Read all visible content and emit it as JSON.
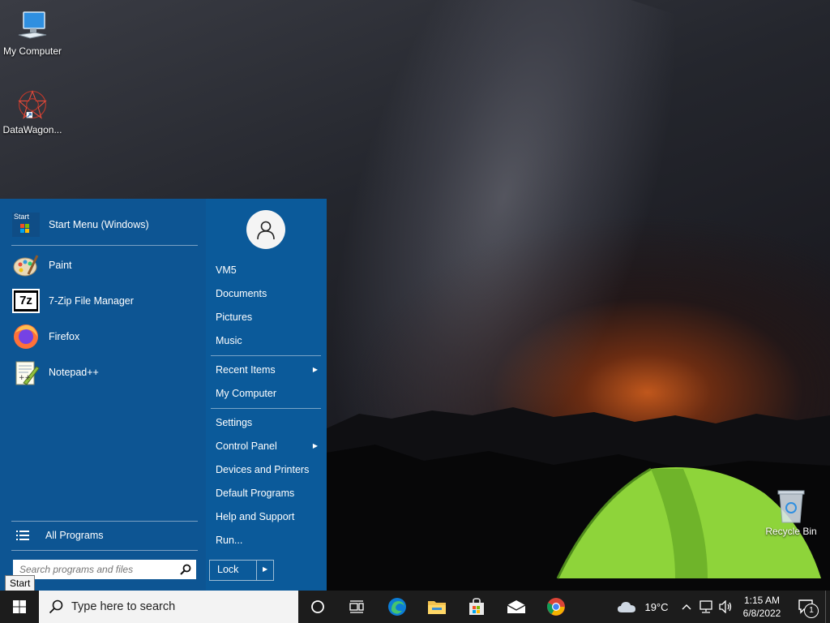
{
  "desktop": {
    "icons": [
      {
        "label": "My Computer",
        "icon": "monitor-icon"
      },
      {
        "label": "DataWagon...",
        "icon": "datawagon-icon"
      },
      {
        "label": "Recycle Bin",
        "icon": "recycle-bin-icon"
      }
    ]
  },
  "start_menu": {
    "pinned": [
      {
        "label": "Start Menu (Windows)",
        "icon": "start-menu-icon"
      },
      {
        "label": "Paint",
        "icon": "paint-icon"
      },
      {
        "label": "7-Zip File Manager",
        "icon": "7zip-icon"
      },
      {
        "label": "Firefox",
        "icon": "firefox-icon"
      },
      {
        "label": "Notepad++",
        "icon": "notepadpp-icon"
      }
    ],
    "start_icon_text": "Start",
    "all_programs": "All Programs",
    "search_placeholder": "Search programs and files",
    "right": {
      "user": "VM5",
      "documents": "Documents",
      "pictures": "Pictures",
      "music": "Music",
      "recent_items": "Recent Items",
      "my_computer": "My Computer",
      "settings": "Settings",
      "control_panel": "Control Panel",
      "devices_printers": "Devices and Printers",
      "default_programs": "Default Programs",
      "help_support": "Help and Support",
      "run": "Run..."
    },
    "lock_label": "Lock"
  },
  "tooltip": "Start",
  "taskbar": {
    "search_placeholder": "Type here to search",
    "weather_temp": "19°C",
    "time": "1:15 AM",
    "date": "6/8/2022",
    "notification_count": "1"
  },
  "colors": {
    "start_menu_bg": "#0b5a9a",
    "taskbar_bg": "#1c1c1c",
    "accent": "#0078d7"
  }
}
